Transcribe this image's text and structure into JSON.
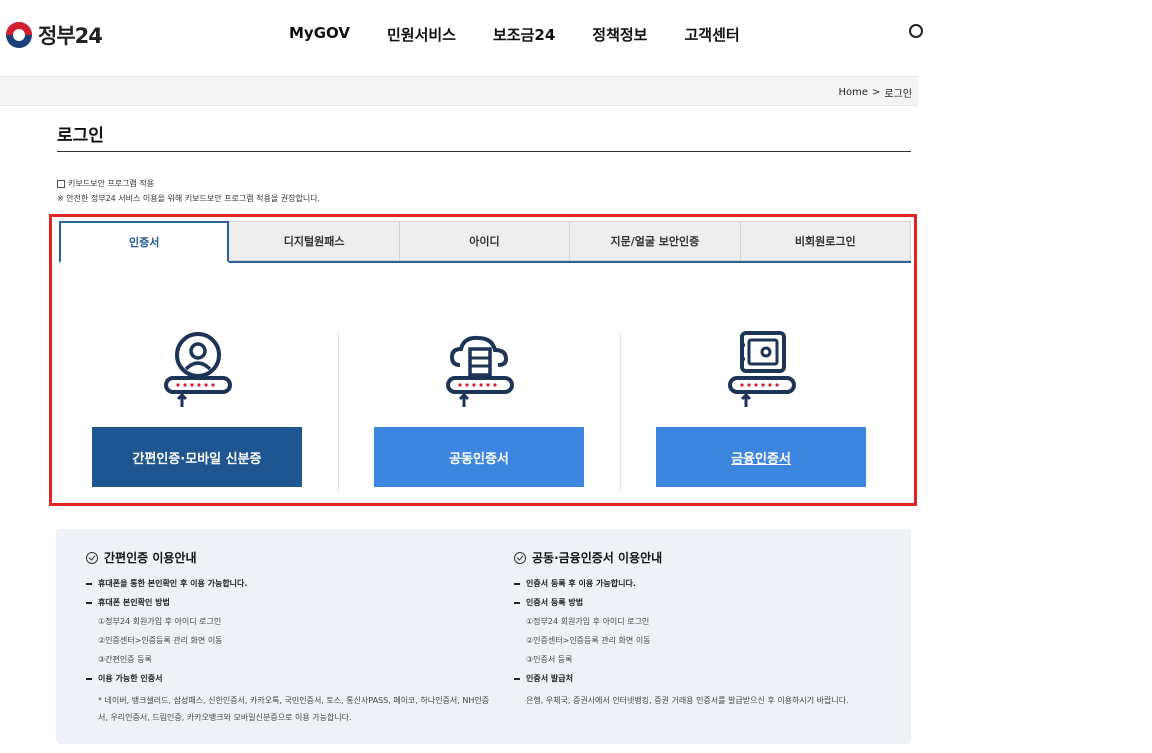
{
  "header": {
    "logo_text": "정부24",
    "nav": [
      "MyGOV",
      "민원서비스",
      "보조금24",
      "정책정보",
      "고객센터"
    ]
  },
  "breadcrumb": {
    "home": "Home",
    "separator": ">",
    "current": "로그인"
  },
  "page_title": "로그인",
  "keyboard": {
    "label": "키보드보안 프로그램 적용",
    "note": "※ 안전한 정부24 서비스 이용을 위해 키보드보안 프로그램 적용을 권장합니다."
  },
  "tabs": [
    {
      "label": "인증서",
      "active": true
    },
    {
      "label": "디지털원패스",
      "active": false
    },
    {
      "label": "아이디",
      "active": false
    },
    {
      "label": "지문/얼굴 보안인증",
      "active": false
    },
    {
      "label": "비회원로그인",
      "active": false
    }
  ],
  "options": [
    {
      "icon": "person-key-icon",
      "label": "간편인증·모바일 신분증"
    },
    {
      "icon": "cloud-server-key-icon",
      "label": "공동인증서"
    },
    {
      "icon": "safe-key-icon",
      "label": "금융인증서"
    }
  ],
  "guide_left": {
    "title": "간편인증 이용안내",
    "item1": "휴대폰을 통한 본인확인 후 이용 가능합니다.",
    "item2": "휴대폰 본인확인 방법",
    "steps": [
      "①정부24 회원가입 후 아이디 로그인",
      "②인증센터>인증등록 관리 화면 이동",
      "③간편인증 등록"
    ],
    "item3": "이용 가능한 인증서",
    "list": "* 네이버, 뱅크샐러드, 삼성패스, 신한인증서, 카카오톡, 국민인증서, 토스, 통신사PASS, 페이코, 하나인증서, NH인증서, 우리인증서, 드림인증, 카카오뱅크와 모바일신분증으로 이용 가능합니다."
  },
  "guide_right": {
    "title": "공동·금융인증서 이용안내",
    "item1": "인증서 등록 후 이용 가능합니다.",
    "item2": "인증서 등록 방법",
    "steps": [
      "①정부24 회원가입 후 아이디 로그인",
      "②인증센터>인증등록 관리 화면 이동",
      "③인증서 등록"
    ],
    "item3": "인증서 발급처",
    "list": "은행, 우체국, 증권사에서 인터넷뱅킹, 증권 거래용 인증서를 발급받으신 후 이용하시기 바랍니다."
  },
  "colors": {
    "accent_dark": "#1d5690",
    "accent_light": "#3d86e0",
    "highlight": "#e02424",
    "icon_navy": "#1c3556",
    "icon_red": "#d3202e"
  }
}
